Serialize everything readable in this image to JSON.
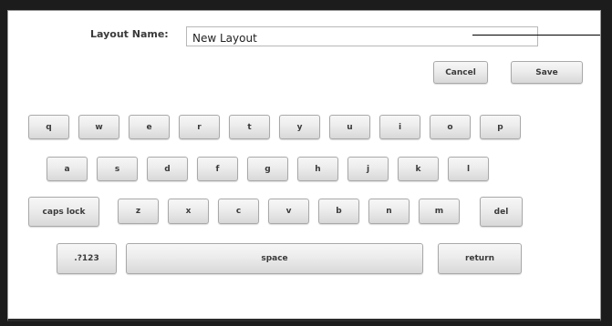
{
  "form": {
    "label": "Layout Name:",
    "value": "New Layout"
  },
  "actions": {
    "cancel_label": "Cancel",
    "save_label": "Save"
  },
  "keyboard": {
    "row1": [
      "q",
      "w",
      "e",
      "r",
      "t",
      "y",
      "u",
      "i",
      "o",
      "p"
    ],
    "row2": [
      "a",
      "s",
      "d",
      "f",
      "g",
      "h",
      "j",
      "k",
      "l"
    ],
    "row3_caps": "caps lock",
    "row3": [
      "z",
      "x",
      "c",
      "v",
      "b",
      "n",
      "m"
    ],
    "row3_del": "del",
    "row4_symbols": ".?123",
    "row4_space": "space",
    "row4_return": "return"
  }
}
